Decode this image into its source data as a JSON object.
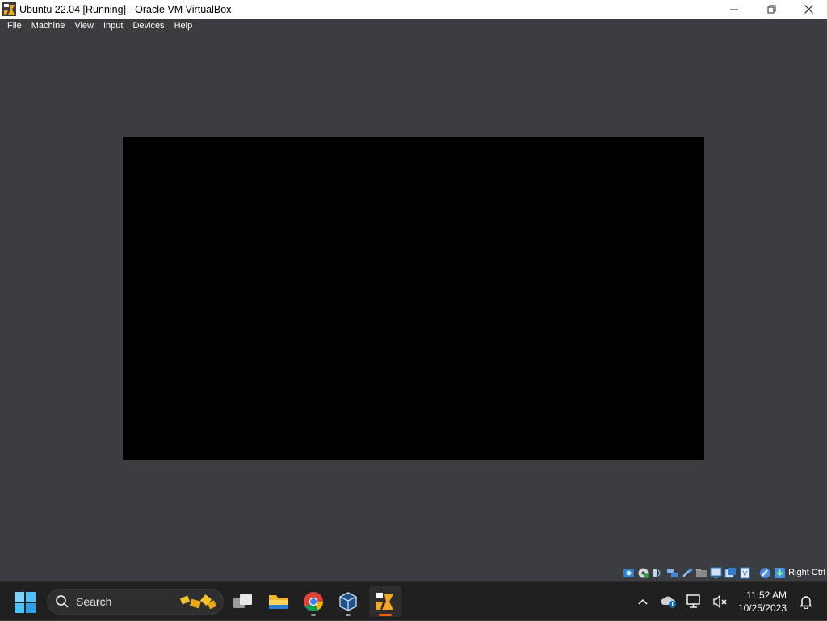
{
  "window": {
    "title": "Ubuntu 22.04 [Running] - Oracle VM VirtualBox",
    "minimize_icon": "minimize-icon",
    "maximize_icon": "restore-icon",
    "close_icon": "close-icon"
  },
  "menu": {
    "items": [
      "File",
      "Machine",
      "View",
      "Input",
      "Devices",
      "Help"
    ]
  },
  "vm": {
    "screen_color": "#000000",
    "background_color": "#3c3d40"
  },
  "statusbar": {
    "icons": [
      "hard-disk-icon",
      "optical-drive-icon",
      "audio-icon",
      "network-icon",
      "usb-icon",
      "shared-folders-icon",
      "display-icon",
      "recording-icon",
      "cpu-icon",
      "mouse-integration-icon",
      "keyboard-capture-icon"
    ],
    "host_key": "Right Ctrl"
  },
  "taskbar": {
    "search_placeholder": "Search",
    "apps": [
      "task-view-icon",
      "file-explorer-icon",
      "chrome-icon",
      "virtualbox-manager-icon",
      "virtualbox-vm-icon"
    ],
    "tray": {
      "overflow_icon": "chevron-up-icon",
      "onedrive_icon": "cloud-icon",
      "network_icon": "network-status-icon",
      "volume_icon": "volume-muted-icon",
      "time": "11:52 AM",
      "date": "10/25/2023",
      "notification_icon": "bell-icon"
    }
  }
}
